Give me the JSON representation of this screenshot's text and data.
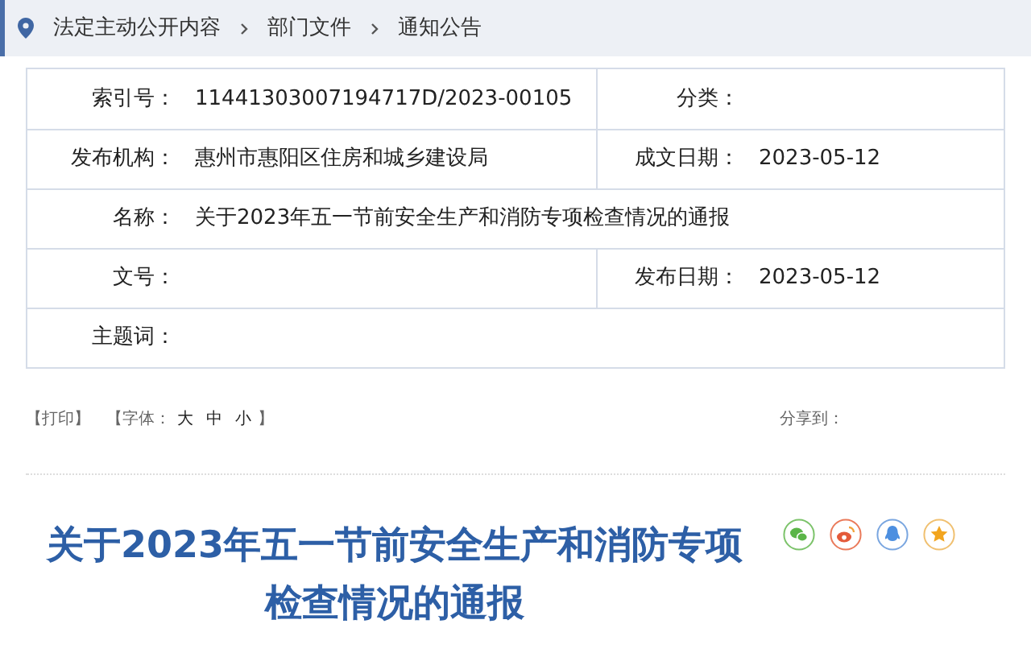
{
  "breadcrumb": [
    "法定主动公开内容",
    "部门文件",
    "通知公告"
  ],
  "info_table": {
    "rows": [
      {
        "kind": "split",
        "cells": [
          {
            "label": "索引号：",
            "value": "11441303007194717D/2023-00105"
          },
          {
            "label": "分类："
          }
        ]
      },
      {
        "kind": "split",
        "cells": [
          {
            "label": "发布机构：",
            "value": "惠州市惠阳区住房和城乡建设局"
          },
          {
            "label": "成文日期：",
            "value": "2023-05-12"
          }
        ]
      },
      {
        "kind": "full",
        "cells": [
          {
            "label": "名称：",
            "value": "关于2023年五一节前安全生产和消防专项检查情况的通报"
          }
        ]
      },
      {
        "kind": "split",
        "cells": [
          {
            "label": "文号："
          },
          {
            "label": "发布日期：",
            "value": "2023-05-12"
          }
        ]
      },
      {
        "kind": "full",
        "cells": [
          {
            "label": "主题词："
          }
        ]
      }
    ]
  },
  "toolbar": {
    "print": "【打印】",
    "font_label": "【字体：",
    "font_sizes": [
      "大",
      "中",
      "小"
    ],
    "font_close": "】",
    "share_label": "分享到："
  },
  "article_title": "关于2023年五一节前安全生产和消防专项检查情况的通报"
}
